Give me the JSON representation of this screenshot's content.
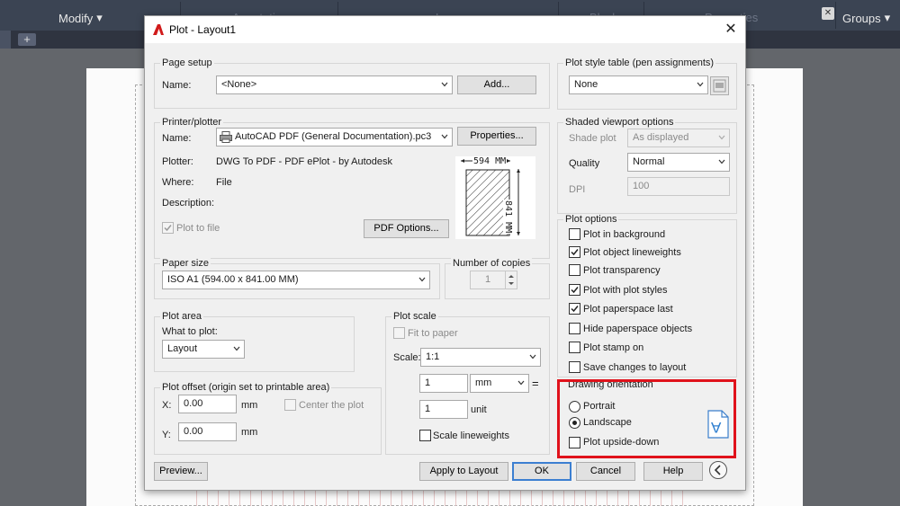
{
  "background": {
    "ribbon_groups": [
      "Modify",
      "Annotation",
      "Layers",
      "Block",
      "Properties",
      "Groups"
    ],
    "accent_highlight": "#e0121b"
  },
  "dialog": {
    "title": "Plot - Layout1",
    "page_setup": {
      "group_title": "Page setup",
      "name_label": "Name:",
      "name_value": "<None>",
      "add_button": "Add..."
    },
    "printer": {
      "group_title": "Printer/plotter",
      "name_label": "Name:",
      "name_value": "AutoCAD PDF (General Documentation).pc3",
      "properties_button": "Properties...",
      "plotter_label": "Plotter:",
      "plotter_value": "DWG To PDF - PDF ePlot - by Autodesk",
      "where_label": "Where:",
      "where_value": "File",
      "description_label": "Description:",
      "plot_to_file_label": "Plot to file",
      "plot_to_file_checked": true,
      "pdf_options_button": "PDF Options...",
      "paper_width_label": "594 MM",
      "paper_height_label": "841 MM"
    },
    "paper_size": {
      "group_title": "Paper size",
      "value": "ISO A1 (594.00 x 841.00 MM)"
    },
    "copies": {
      "group_title": "Number of copies",
      "value": "1"
    },
    "plot_area": {
      "group_title": "Plot area",
      "what_label": "What to plot:",
      "what_value": "Layout"
    },
    "plot_scale": {
      "group_title": "Plot scale",
      "fit_label": "Fit to paper",
      "scale_label": "Scale:",
      "scale_value": "1:1",
      "num_value": "1",
      "unit_combo": "mm",
      "eq": "=",
      "denom_value": "1",
      "unit_label": "unit",
      "scale_lineweights_label": "Scale lineweights"
    },
    "plot_offset": {
      "group_title": "Plot offset (origin set to printable area)",
      "x_label": "X:",
      "x_value": "0.00",
      "x_unit": "mm",
      "y_label": "Y:",
      "y_value": "0.00",
      "y_unit": "mm",
      "center_label": "Center the plot"
    },
    "style_table": {
      "group_title": "Plot style table (pen assignments)",
      "value": "None"
    },
    "shaded": {
      "group_title": "Shaded viewport options",
      "shade_label": "Shade plot",
      "shade_value": "As displayed",
      "quality_label": "Quality",
      "quality_value": "Normal",
      "dpi_label": "DPI",
      "dpi_value": "100"
    },
    "plot_options": {
      "group_title": "Plot options",
      "items": [
        {
          "label": "Plot in background",
          "checked": false
        },
        {
          "label": "Plot object lineweights",
          "checked": true
        },
        {
          "label": "Plot transparency",
          "checked": false
        },
        {
          "label": "Plot with plot styles",
          "checked": true
        },
        {
          "label": "Plot paperspace last",
          "checked": true
        },
        {
          "label": "Hide paperspace objects",
          "checked": false
        },
        {
          "label": "Plot stamp on",
          "checked": false
        },
        {
          "label": "Save changes to layout",
          "checked": false
        }
      ]
    },
    "orientation": {
      "group_title": "Drawing orientation",
      "portrait_label": "Portrait",
      "landscape_label": "Landscape",
      "selected": "Landscape",
      "upside_down_label": "Plot upside-down",
      "upside_down_checked": false,
      "preview_glyph": "A"
    },
    "buttons": {
      "preview": "Preview...",
      "apply": "Apply to Layout",
      "ok": "OK",
      "cancel": "Cancel",
      "help": "Help"
    }
  }
}
